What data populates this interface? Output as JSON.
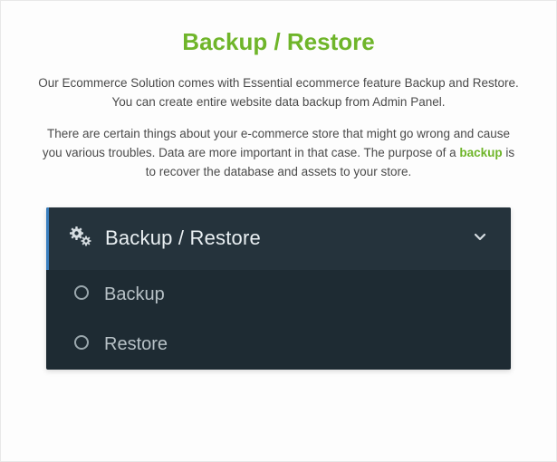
{
  "title": "Backup / Restore",
  "para1": "Our Ecommerce Solution comes with Essential ecommerce feature Backup and Restore. You can create entire website data backup from Admin Panel.",
  "para2a": "There are certain things about your e-commerce store that might go wrong and cause you various troubles. Data are more important in that case. The purpose of a ",
  "para2accent": "backup",
  "para2b": " is to recover the database and assets to your store.",
  "panel": {
    "header": "Backup / Restore",
    "items": [
      "Backup",
      "Restore"
    ]
  }
}
